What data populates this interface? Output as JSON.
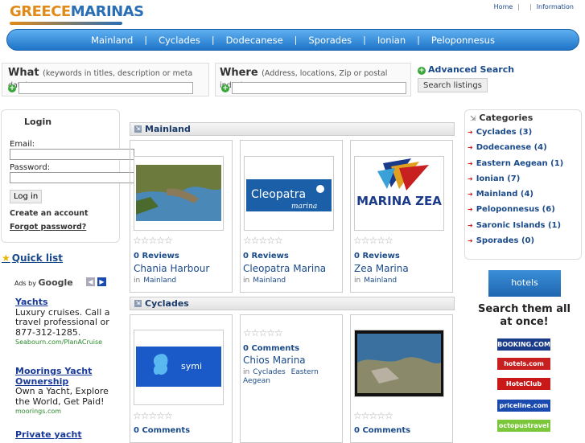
{
  "logo": {
    "part1": "GREECE",
    "part2": "MARINAS"
  },
  "top_links": [
    "Home",
    "Information"
  ],
  "nav": [
    "Mainland",
    "Cyclades",
    "Dodecanese",
    "Sporades",
    "Ionian",
    "Peloponnesus"
  ],
  "search": {
    "what_label": "What",
    "what_hint": "(keywords in titles, description or meta data)",
    "where_label": "Where",
    "where_hint": "(Address, locations, Zip or postal index)",
    "advanced": "Advanced Search",
    "button": "Search listings"
  },
  "login": {
    "title": "Login",
    "email_label": "Email:",
    "password_label": "Password:",
    "button": "Log in",
    "create": "Create an account",
    "forgot": "Forgot password?"
  },
  "quicklist": "Quick list",
  "ads": {
    "ads_by": "Ads by",
    "google": "Google",
    "items": [
      {
        "title": "Yachts",
        "text": "Luxury cruises. Call a travel professional or 877-312-1285.",
        "url": "Seabourn.com/PlanACruise"
      },
      {
        "title": "Moorings Yacht Ownership",
        "text": "Own a Yacht, Explore the World, Get Paid!",
        "url": "moorings.com"
      },
      {
        "title": "Private yacht",
        "text": "",
        "url": ""
      }
    ]
  },
  "sections": [
    {
      "name": "Mainland",
      "cards": [
        {
          "reviews": "0 Reviews",
          "title": "Chania Harbour",
          "in": "in",
          "cats": [
            "Mainland"
          ]
        },
        {
          "reviews": "0 Reviews",
          "title": "Cleopatra Marina",
          "in": "in",
          "cats": [
            "Mainland"
          ],
          "logo_main": "Cleopatra",
          "logo_sub": "marina"
        },
        {
          "reviews": "0 Reviews",
          "title": "Zea Marina",
          "in": "in",
          "cats": [
            "Mainland"
          ],
          "logo_main": "MARINA ZEA"
        }
      ]
    },
    {
      "name": "Cyclades",
      "cards": [
        {
          "reviews": "0 Comments",
          "title": "",
          "in": "",
          "cats": [],
          "logo_main": "symi"
        },
        {
          "reviews": "0 Comments",
          "title": "Chios Marina",
          "in": "in",
          "cats": [
            "Cyclades",
            "Eastern Aegean"
          ]
        },
        {
          "reviews": "0 Comments",
          "title": "",
          "in": "",
          "cats": []
        }
      ]
    }
  ],
  "categories": {
    "title": "Categories",
    "items": [
      "Cyclades (3)",
      "Dodecanese (4)",
      "Eastern Aegean (1)",
      "Ionian (7)",
      "Mainland (4)",
      "Peloponnesus (6)",
      "Saronic Islands (1)",
      "Sporades (0)"
    ]
  },
  "hotels": {
    "logo": "hotels combined",
    "tagline": "Search them all at once!",
    "brands": [
      "BOOKING.COM",
      "hotels.com",
      "HotelClub",
      "priceline.com",
      "octopustravel"
    ]
  },
  "colors": {
    "nav_top": "#5fb0f0",
    "nav_bottom": "#1e74c8",
    "link": "#1a4a8a",
    "plus_icon": "#3aa63a"
  }
}
